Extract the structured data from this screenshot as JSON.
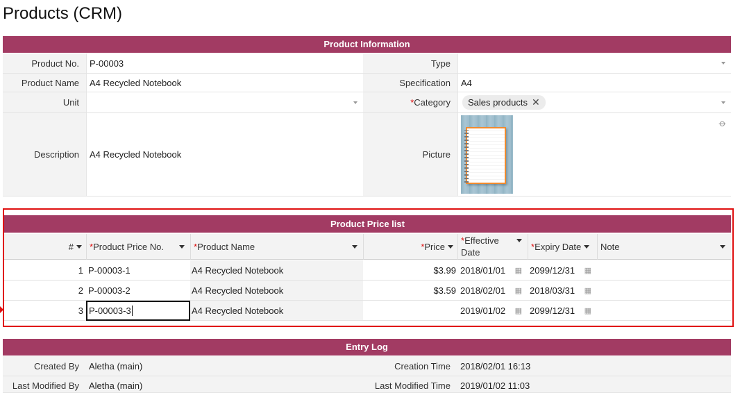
{
  "page": {
    "title": "Products (CRM)"
  },
  "sections": {
    "product_info": "Product Information",
    "price_list": "Product Price list",
    "entry_log": "Entry Log"
  },
  "product": {
    "product_no_label": "Product No.",
    "product_no": "P-00003",
    "type_label": "Type",
    "type": "",
    "product_name_label": "Product Name",
    "product_name": "A4 Recycled Notebook",
    "specification_label": "Specification",
    "specification": "A4",
    "unit_label": "Unit",
    "unit": "",
    "category_label": "Category",
    "category_chip": "Sales products",
    "description_label": "Description",
    "description": "A4 Recycled Notebook",
    "picture_label": "Picture"
  },
  "price_list": {
    "columns": {
      "num": "#",
      "price_no": "Product Price No.",
      "product_name": "Product Name",
      "price": "Price",
      "effective_date_1": "Effective",
      "effective_date_2": "Date",
      "expiry_date": "Expiry Date",
      "note": "Note"
    },
    "rows": [
      {
        "num": "1",
        "price_no": "P-00003-1",
        "product_name": "A4 Recycled Notebook",
        "price": "$3.99",
        "effective": "2018/01/01",
        "expiry": "2099/12/31",
        "note": ""
      },
      {
        "num": "2",
        "price_no": "P-00003-2",
        "product_name": "A4 Recycled Notebook",
        "price": "$3.59",
        "effective": "2018/02/01",
        "expiry": "2018/03/31",
        "note": ""
      },
      {
        "num": "3",
        "price_no": "P-00003-3",
        "product_name": "A4 Recycled Notebook",
        "price": "",
        "effective": "2019/01/02",
        "expiry": "2099/12/31",
        "note": ""
      }
    ]
  },
  "entry_log": {
    "created_by_label": "Created By",
    "created_by": "Aletha (main)",
    "creation_time_label": "Creation Time",
    "creation_time": "2018/02/01 16:13",
    "modified_by_label": "Last Modified By",
    "modified_by": "Aletha (main)",
    "modified_time_label": "Last Modified Time",
    "modified_time": "2019/01/02 11:03"
  },
  "colors": {
    "section_bar": "#a23b63",
    "highlight_frame": "#e01010"
  }
}
